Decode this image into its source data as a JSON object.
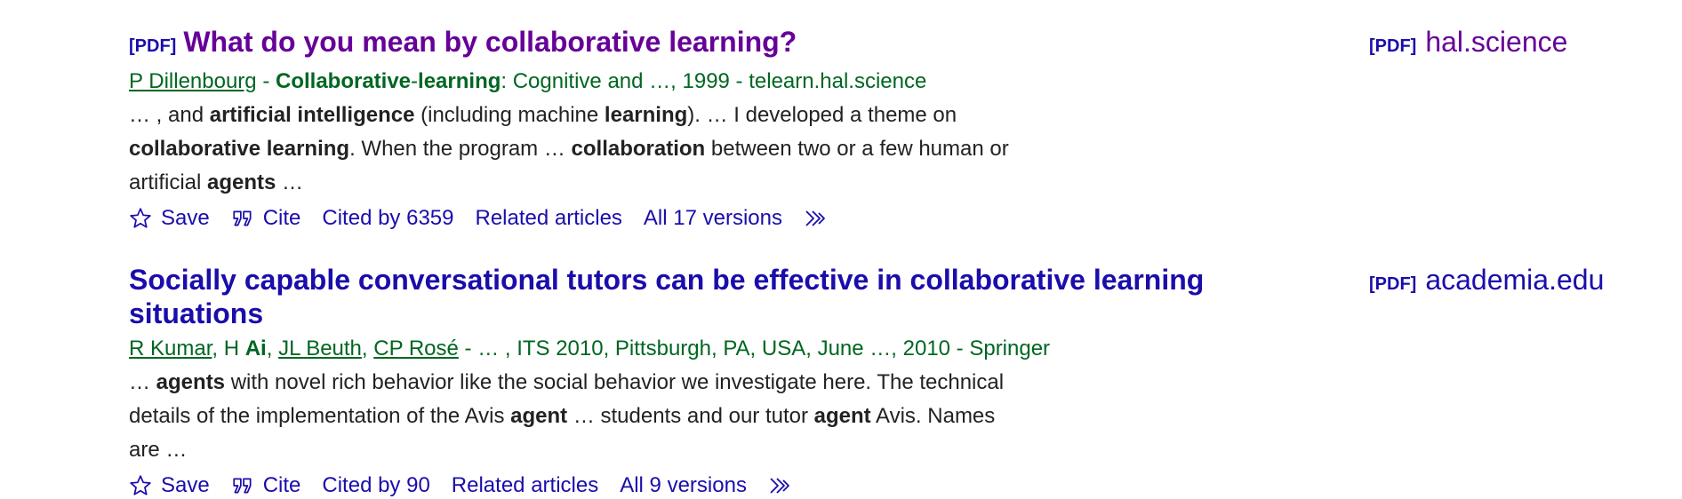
{
  "results": [
    {
      "pdf_tag": "[PDF]",
      "title_parts": [
        "What do you mean by ",
        "collaborative learning",
        "?"
      ],
      "byline": {
        "author1": "P Dillenbourg",
        "sep1": " - ",
        "source_bold1": "Collaborative",
        "source_dash": "-",
        "source_bold2": "learning",
        "source_rest": ": Cognitive and …, 1999 - telearn.hal.science"
      },
      "snippet_parts": [
        "… , and ",
        "artificial intelligence",
        " (including machine ",
        "learning",
        "). … I developed a theme on ",
        "collaborative learning",
        ". When the program … ",
        "collaboration",
        " between two or a few human or artificial ",
        "agents",
        " …"
      ],
      "actions": {
        "save": "Save",
        "cite": "Cite",
        "cited_by": "Cited by 6359",
        "related": "Related articles",
        "versions": "All 17 versions"
      },
      "side": {
        "pdf_tag": "[PDF]",
        "domain": "hal.science"
      }
    },
    {
      "title_parts": [
        "Socially capable conversational tutors can be effective in ",
        "collaborative learning",
        " situations"
      ],
      "byline": {
        "author1": "R Kumar",
        "sep_a": ", H ",
        "author2_bold": "Ai",
        "sep_b": ", ",
        "author3": "JL Beuth",
        "sep_c": ", ",
        "author4": "CP Rosé",
        "rest": " - … , ITS 2010, Pittsburgh, PA, USA, June …, 2010 - Springer"
      },
      "snippet_parts": [
        "… ",
        "agents",
        " with novel rich behavior like the social behavior we investigate here. The technical details of the implementation of the Avis ",
        "agent",
        " … students and our tutor ",
        "agent",
        " Avis. Names are …"
      ],
      "actions": {
        "save": "Save",
        "cite": "Cite",
        "cited_by": "Cited by 90",
        "related": "Related articles",
        "versions": "All 9 versions"
      },
      "side": {
        "pdf_tag": "[PDF]",
        "domain": "academia.edu"
      }
    }
  ]
}
